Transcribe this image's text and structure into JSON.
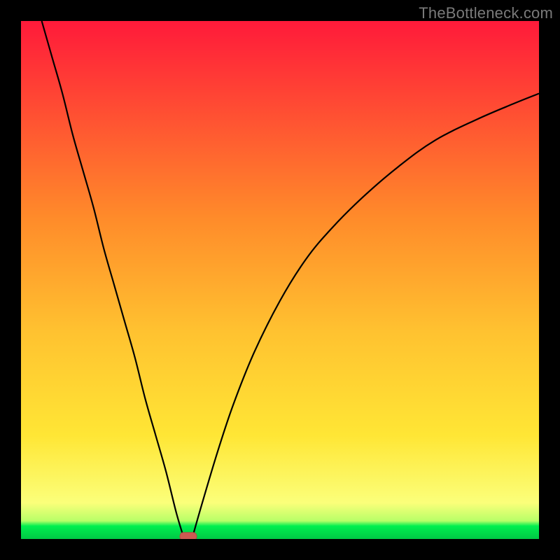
{
  "watermark": "TheBottleneck.com",
  "colors": {
    "frame": "#000000",
    "gradient_top": "#ff1a3a",
    "gradient_mid_upper": "#ff8b2a",
    "gradient_mid": "#ffe635",
    "gradient_low": "#fbff7a",
    "gradient_green": "#00ef4f",
    "curve": "#000000",
    "marker_fill": "#cc5a52",
    "marker_stroke": "#b34a44"
  },
  "chart_data": {
    "type": "line",
    "title": "",
    "xlabel": "",
    "ylabel": "",
    "xlim": [
      0,
      100
    ],
    "ylim": [
      0,
      100
    ],
    "series": [
      {
        "name": "left-branch",
        "x": [
          4,
          6,
          8,
          10,
          12,
          14,
          16,
          18,
          20,
          22,
          24,
          26,
          28,
          30,
          31.5
        ],
        "values": [
          100,
          93,
          86,
          78,
          71,
          64,
          56,
          49,
          42,
          35,
          27,
          20,
          13,
          5,
          0
        ]
      },
      {
        "name": "right-branch",
        "x": [
          33,
          35,
          38,
          41,
          45,
          50,
          55,
          60,
          66,
          73,
          80,
          88,
          95,
          100
        ],
        "values": [
          0,
          7,
          17,
          26,
          36,
          46,
          54,
          60,
          66,
          72,
          77,
          81,
          84,
          86
        ]
      }
    ],
    "annotations": [
      {
        "name": "minimum-marker",
        "x": 32.3,
        "y": 0.5,
        "shape": "rounded-rect"
      }
    ],
    "gradient_stops_pct": [
      0,
      38,
      60,
      80,
      93,
      96.5,
      97.5,
      100
    ],
    "gradient_colors": [
      "#ff1a3a",
      "#ff8b2a",
      "#ffc230",
      "#ffe635",
      "#fbff7a",
      "#b8ff68",
      "#00ef4f",
      "#00c845"
    ]
  }
}
